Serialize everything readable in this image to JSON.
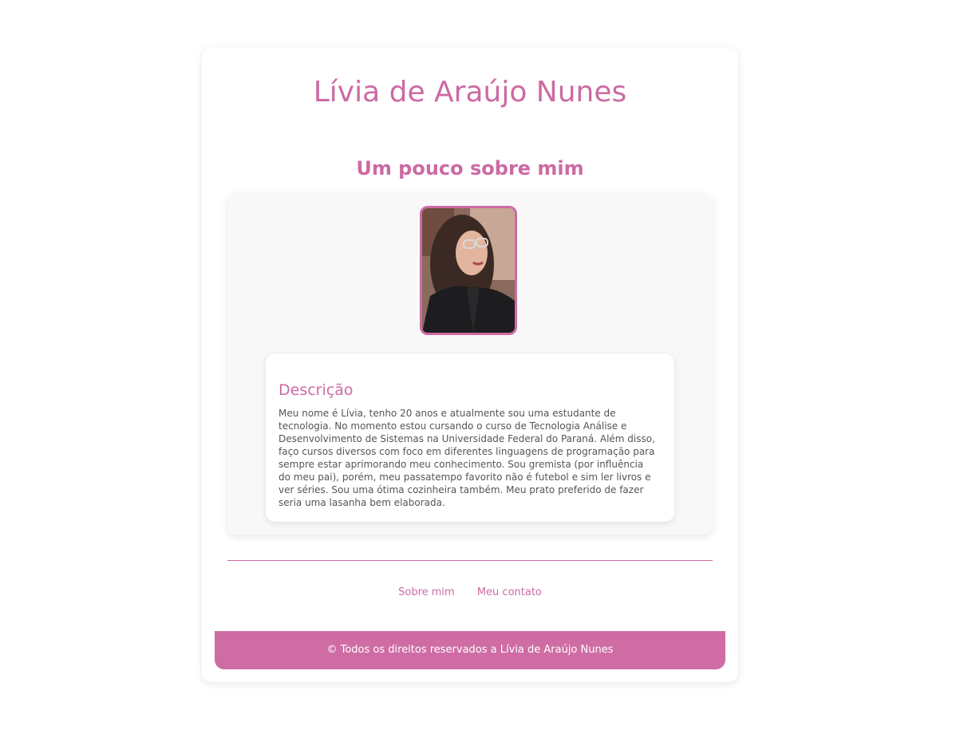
{
  "header": {
    "title": "Lívia de Araújo Nunes"
  },
  "about": {
    "section_title": "Um pouco sobre mim",
    "photo_icon": "profile-photo",
    "description_title": "Descrição",
    "description_text": "Meu nome é Lívia, tenho 20 anos e atualmente sou uma estudante de tecnologia. No momento estou cursando o curso de Tecnologia Análise e Desenvolvimento de Sistemas na Universidade Federal do Paraná. Além disso, faço cursos diversos com foco em diferentes linguagens de programação para sempre estar aprimorando meu conhecimento. Sou gremista (por influência do meu pai), porém, meu passatempo favorito não é futebol e sim ler livros e ver séries. Sou uma ótima cozinheira também. Meu prato preferido de fazer seria uma lasanha bem elaborada."
  },
  "nav": {
    "items": [
      {
        "label": "Sobre mim"
      },
      {
        "label": "Meu contato"
      }
    ]
  },
  "footer": {
    "text": "© Todos os direitos reservados a Lívia de Araújo Nunes"
  },
  "colors": {
    "accent": "#cc6aa3",
    "footer_bg": "#cf6ca4",
    "panel_bg": "#f8f8f8"
  }
}
